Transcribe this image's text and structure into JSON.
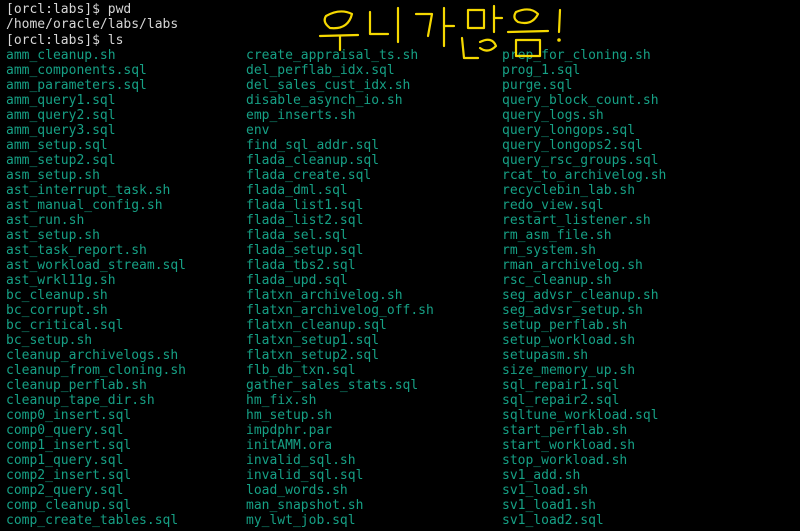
{
  "terminal": {
    "prompt_line_1": "[orcl:labs]$ pwd",
    "pwd_output": "/home/oracle/labs/labs",
    "prompt_line_2": "[orcl:labs]$ ls"
  },
  "handwritten_annotation": "우니가 많음 !",
  "colors": {
    "background": "#000000",
    "prompt_text": "#d6d6d6",
    "file_text": "#16a085",
    "annotation": "#f5d800"
  },
  "columns": [
    [
      "amm_cleanup.sh",
      "amm_components.sql",
      "amm_parameters.sql",
      "amm_query1.sql",
      "amm_query2.sql",
      "amm_query3.sql",
      "amm_setup.sql",
      "amm_setup2.sql",
      "asm_setup.sh",
      "ast_interrupt_task.sh",
      "ast_manual_config.sh",
      "ast_run.sh",
      "ast_setup.sh",
      "ast_task_report.sh",
      "ast_workload_stream.sql",
      "ast_wrkl11g.sh",
      "bc_cleanup.sh",
      "bc_corrupt.sh",
      "bc_critical.sql",
      "bc_setup.sh",
      "cleanup_archivelogs.sh",
      "cleanup_from_cloning.sh",
      "cleanup_perflab.sh",
      "cleanup_tape_dir.sh",
      "comp0_insert.sql",
      "comp0_query.sql",
      "comp1_insert.sql",
      "comp1_query.sql",
      "comp2_insert.sql",
      "comp2_query.sql",
      "comp_cleanup.sql",
      "comp_create_tables.sql"
    ],
    [
      "create_appraisal_ts.sh",
      "del_perflab_idx.sql",
      "del_sales_cust_idx.sh",
      "disable_asynch_io.sh",
      "emp_inserts.sh",
      "env",
      "find_sql_addr.sql",
      "flada_cleanup.sql",
      "flada_create.sql",
      "flada_dml.sql",
      "flada_list1.sql",
      "flada_list2.sql",
      "flada_sel.sql",
      "flada_setup.sql",
      "flada_tbs2.sql",
      "flada_upd.sql",
      "flatxn_archivelog.sh",
      "flatxn_archivelog_off.sh",
      "flatxn_cleanup.sql",
      "flatxn_setup1.sql",
      "flatxn_setup2.sql",
      "flb_db_txn.sql",
      "gather_sales_stats.sql",
      "hm_fix.sh",
      "hm_setup.sh",
      "impdphr.par",
      "initAMM.ora",
      "invalid_sql.sh",
      "invalid_sql.sql",
      "load_words.sh",
      "man_snapshot.sh",
      "my_lwt_job.sql"
    ],
    [
      "prep_for_cloning.sh",
      "prog_1.sql",
      "purge.sql",
      "query_block_count.sh",
      "query_logs.sh",
      "query_longops.sql",
      "query_longops2.sql",
      "query_rsc_groups.sql",
      "rcat_to_archivelog.sh",
      "recyclebin_lab.sh",
      "redo_view.sql",
      "restart_listener.sh",
      "rm_asm_file.sh",
      "rm_system.sh",
      "rman_archivelog.sh",
      "rsc_cleanup.sh",
      "seg_advsr_cleanup.sh",
      "seg_advsr_setup.sh",
      "setup_perflab.sh",
      "setup_workload.sh",
      "setupasm.sh",
      "size_memory_up.sh",
      "sql_repair1.sql",
      "sql_repair2.sql",
      "sqltune_workload.sql",
      "start_perflab.sh",
      "start_workload.sh",
      "stop_workload.sh",
      "sv1_add.sh",
      "sv1_load.sh",
      "sv1_load1.sh",
      "sv1_load2.sql"
    ]
  ]
}
